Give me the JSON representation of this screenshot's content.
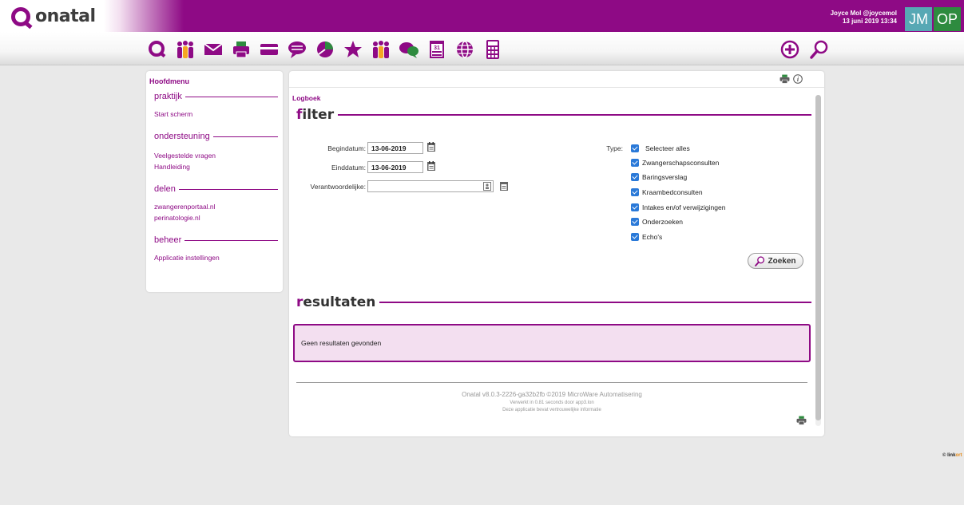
{
  "app": {
    "logo_text": "onatal",
    "brand_color": "#8e0a85"
  },
  "user": {
    "name": "Joyce Mol @joycemol",
    "datetime": "13 juni 2019 13:34",
    "avatars": [
      "JM",
      "OP"
    ]
  },
  "toolbar": {
    "icons": [
      "refresh-icon",
      "people-icon",
      "mail-icon",
      "printer-icon",
      "card-icon",
      "speech-bubble-icon",
      "pie-chart-icon",
      "star-icon",
      "group-icon",
      "chat-icon",
      "calendar-icon",
      "globe-icon",
      "calculator-icon"
    ],
    "right_icons": [
      "add-icon",
      "search-icon"
    ]
  },
  "sidebar": {
    "title": "Hoofdmenu",
    "sections": [
      {
        "heading": "praktijk",
        "links": [
          "Start scherm"
        ]
      },
      {
        "heading": "ondersteuning",
        "links": [
          "Veelgestelde vragen",
          "Handleiding"
        ]
      },
      {
        "heading": "delen",
        "links": [
          "zwangerenportaal.nl",
          "perinatologie.nl"
        ]
      },
      {
        "heading": "beheer",
        "links": [
          "Applicatie instellingen"
        ]
      }
    ]
  },
  "main": {
    "breadcrumb": "Logboek",
    "filter": {
      "title_first": "f",
      "title_rest": "ilter",
      "begindatum_label": "Begindatum:",
      "begindatum_value": "13-06-2019",
      "einddatum_label": "Einddatum:",
      "einddatum_value": "13-06-2019",
      "verantwoordelijke_label": "Verantwoordelijke:",
      "verantwoordelijke_value": "",
      "type_label": "Type:",
      "types": [
        "Selecteer alles",
        "Zwangerschapsconsulten",
        "Baringsverslag",
        "Kraambedconsulten",
        "Intakes en/of verwijzigingen",
        "Onderzoeken",
        "Echo's"
      ],
      "search_label": "Zoeken"
    },
    "results": {
      "title_first": "r",
      "title_rest": "esultaten",
      "message": "Geen resultaten gevonden"
    },
    "footer": {
      "version": "Onatal v8.0.3-2226-ga32b2fb ©2019 MicroWare Automatisering",
      "processed": "Verwerkt in 0.81 seconds door app3.lon",
      "confidential": "Deze applicatie bevat vertrouwelijke informatie"
    }
  },
  "badge": {
    "prefix": "© link",
    "suffix": "ort"
  }
}
